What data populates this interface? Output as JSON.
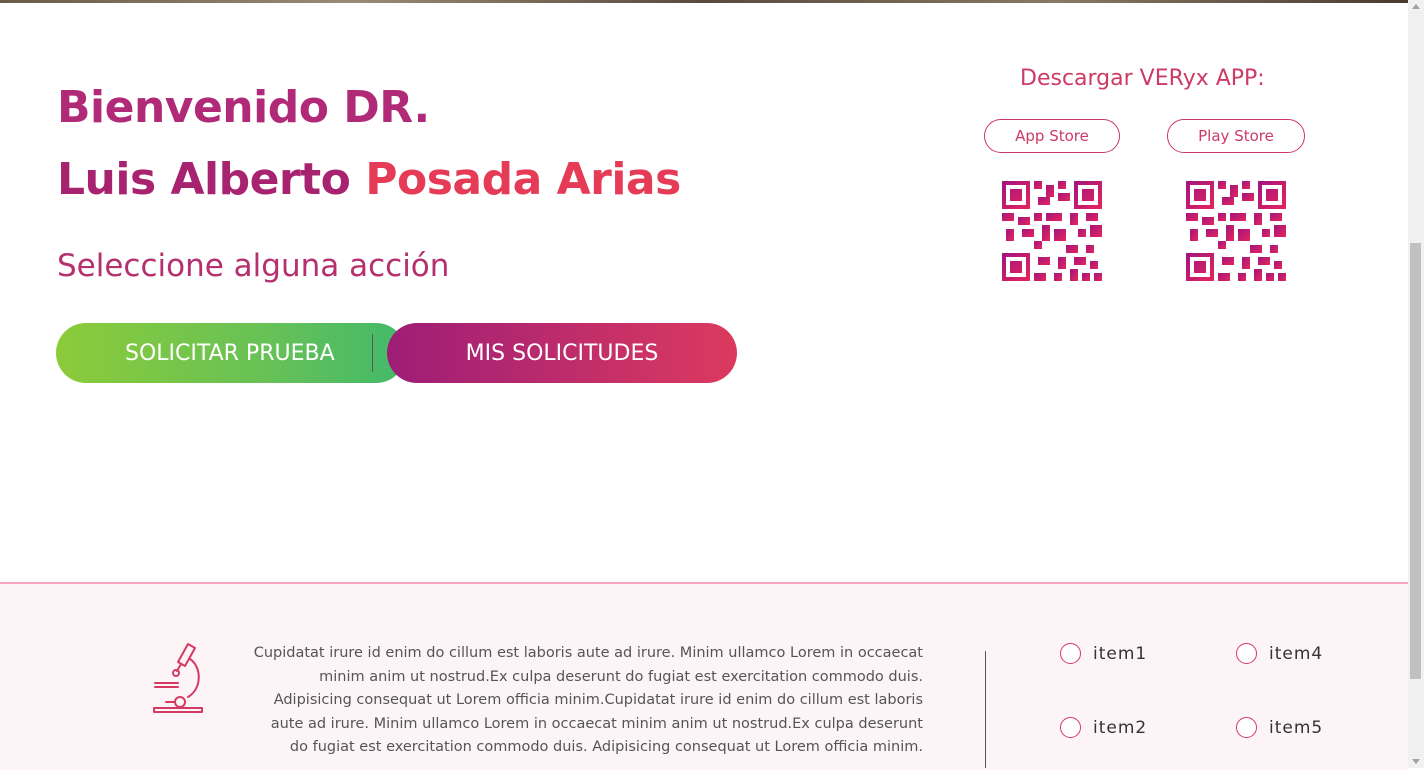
{
  "welcome": {
    "line1": "Bienvenido DR.",
    "line2_first": "Luis Alberto",
    "line2_last": "Posada Arias"
  },
  "subtitle": "Seleccione alguna acción",
  "actions": {
    "solicitar": "SOLICITAR PRUEBA",
    "mis_solicitudes": "MIS SOLICITUDES"
  },
  "download": {
    "title": "Descargar VERyx APP:",
    "app_store": "App Store",
    "play_store": "Play Store"
  },
  "footer": {
    "description": "Cupidatat irure id enim do cillum est laboris aute ad irure. Minim ullamco Lorem in occaecat minim anim ut nostrud.Ex culpa deserunt do fugiat est exercitation commodo duis. Adipisicing consequat ut Lorem officia minim.Cupidatat irure id enim do cillum est laboris aute ad irure. Minim ullamco Lorem in occaecat minim anim ut nostrud.Ex culpa deserunt do fugiat est exercitation commodo duis. Adipisicing consequat ut Lorem officia minim.",
    "items": [
      "item1",
      "item2",
      "item4",
      "item5"
    ],
    "icon": "microscope-icon"
  },
  "colors": {
    "primary": "#cc3a65",
    "magenta": "#a8236f",
    "green": "#67c156",
    "coral": "#e53b57"
  }
}
